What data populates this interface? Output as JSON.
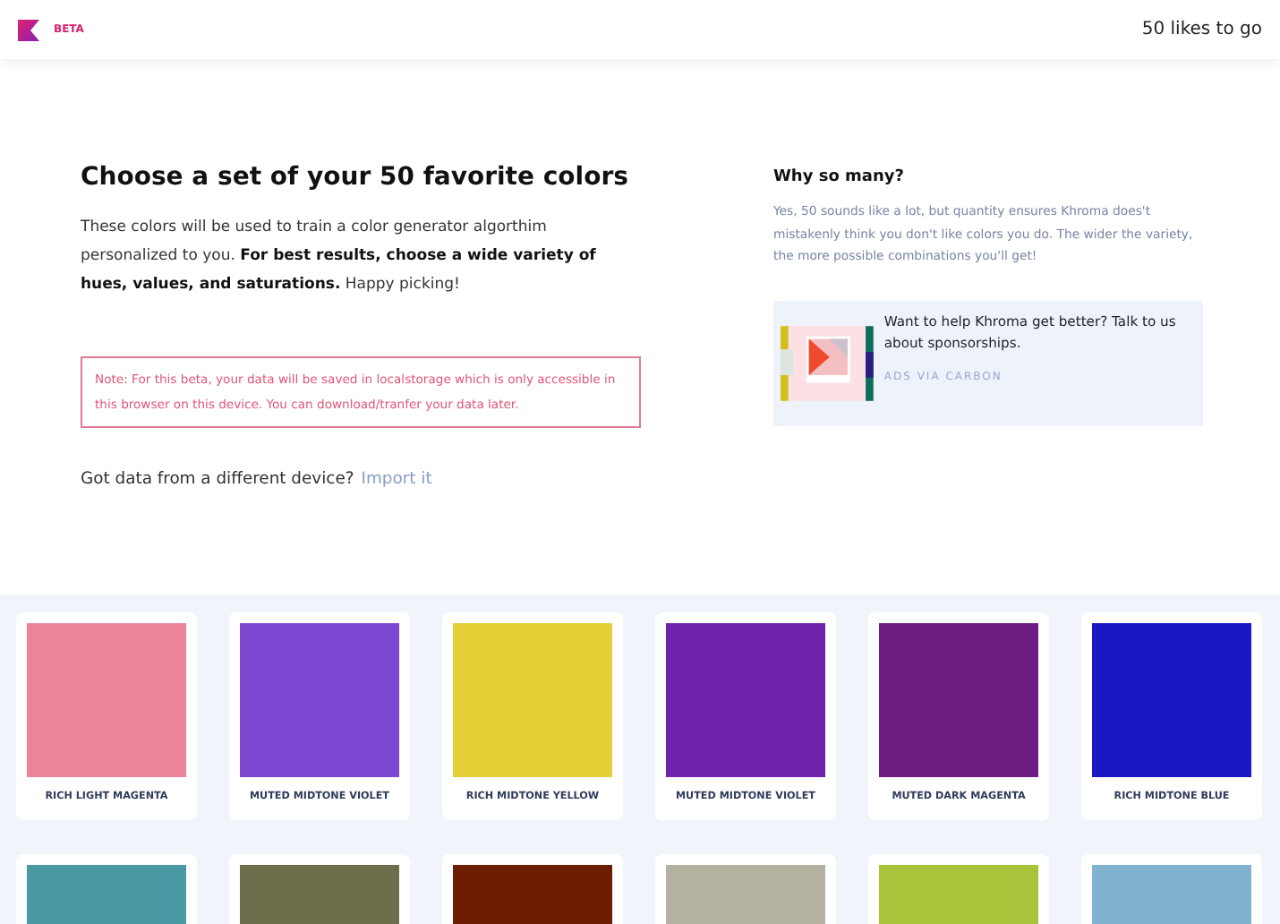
{
  "header": {
    "badge": "BETA",
    "likes_left": "50 likes to go"
  },
  "intro": {
    "title": "Choose a set of your 50 favorite colors",
    "body": "These colors will be used to train a color generator algorthim personalized to you. **For best results, choose a wide variety of hues, values, and saturations.** Happy picking!",
    "note": "Note: For this beta, your data will be saved in localstorage which is only accessible in this browser on this device. You can download/tranfer your data later.",
    "import_prompt": "Got data from a different device?",
    "import_link": "Import it"
  },
  "aside": {
    "title": "Why so many?",
    "body": "Yes, 50 sounds like a lot, but quantity ensures Khroma does't mistakenly think you don't like colors you do. The wider the variety, the more possible combinations you'll get!",
    "ad_text": "Want to help Khroma get better? Talk to us about sponsorships.",
    "ad_credit": "ADS VIA CARBON"
  },
  "swatches": [
    {
      "name": "RICH LIGHT MAGENTA",
      "color": "#ec849b"
    },
    {
      "name": "MUTED MIDTONE VIOLET",
      "color": "#7c48d2"
    },
    {
      "name": "RICH MIDTONE YELLOW",
      "color": "#e2cf35"
    },
    {
      "name": "MUTED MIDTONE VIOLET",
      "color": "#6f22ad"
    },
    {
      "name": "MUTED DARK MAGENTA",
      "color": "#6e1e82"
    },
    {
      "name": "RICH MIDTONE BLUE",
      "color": "#1a18c4"
    },
    {
      "color": "#4a9aa6"
    },
    {
      "color": "#6c6d4b"
    },
    {
      "color": "#6d1d00"
    },
    {
      "color": "#b5b1a0"
    },
    {
      "color": "#a8c43a"
    },
    {
      "color": "#7fb3cf"
    }
  ]
}
